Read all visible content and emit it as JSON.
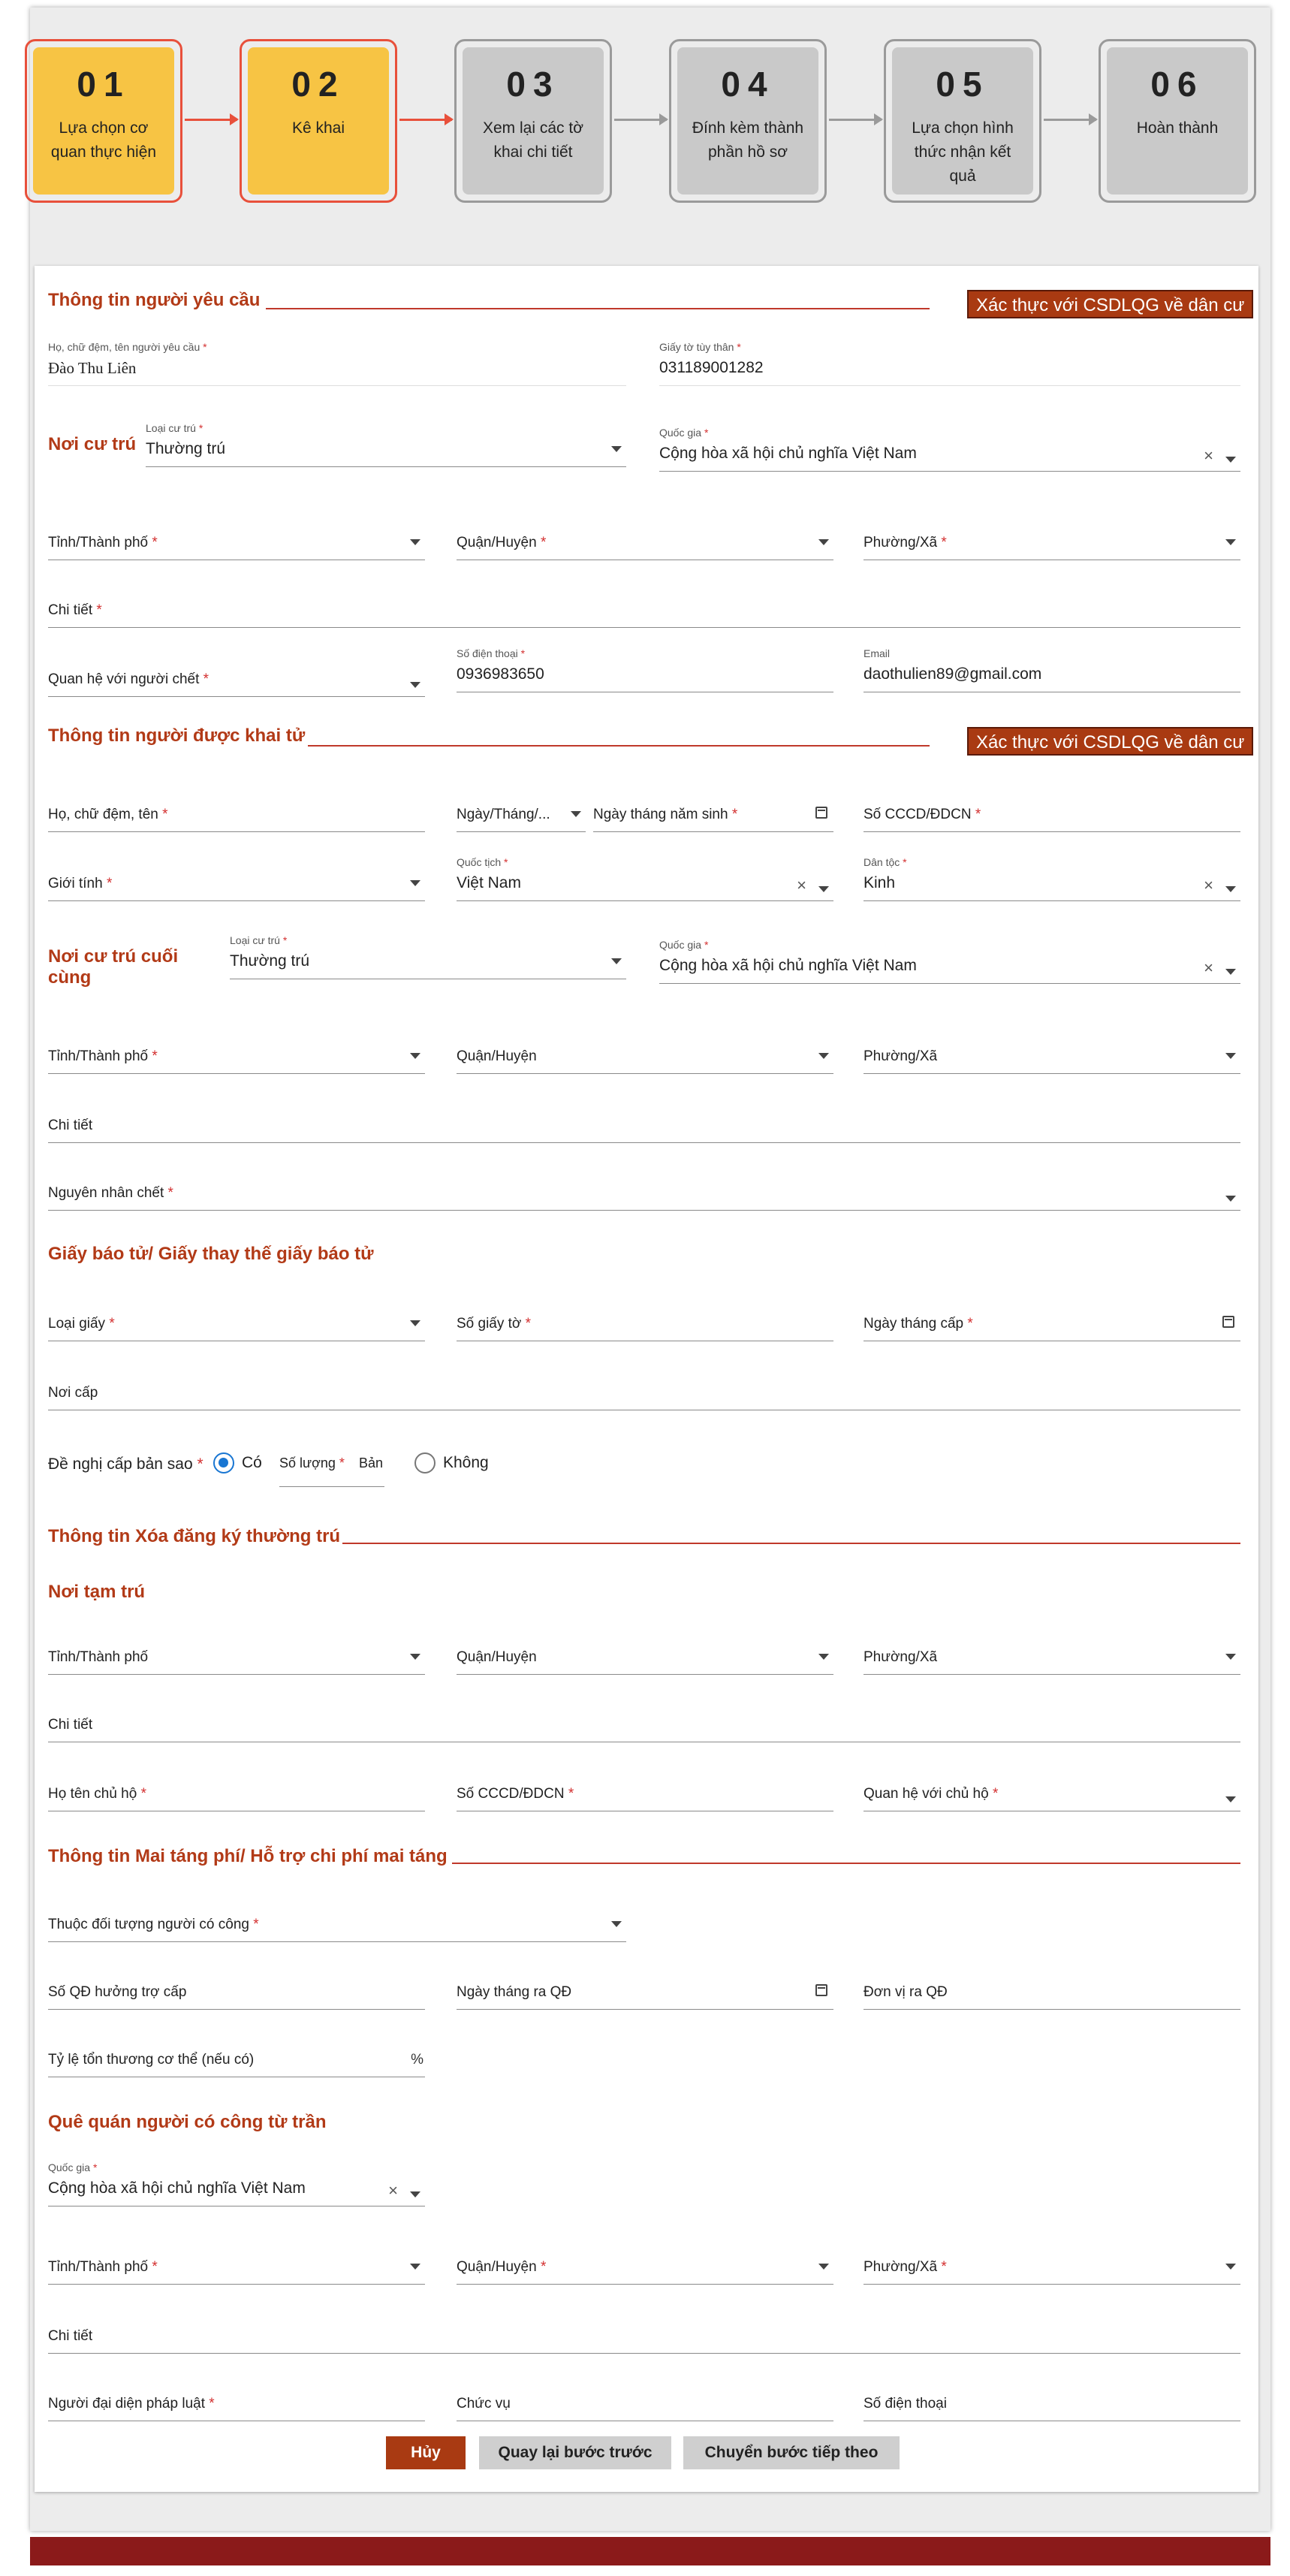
{
  "steps": [
    {
      "num": "01",
      "label": "Lựa chọn cơ quan thực hiện"
    },
    {
      "num": "02",
      "label": "Kê khai"
    },
    {
      "num": "03",
      "label": "Xem lại các tờ khai chi tiết"
    },
    {
      "num": "04",
      "label": "Đính kèm thành phần hồ sơ"
    },
    {
      "num": "05",
      "label": "Lựa chọn hình thức nhận kết quả"
    },
    {
      "num": "06",
      "label": "Hoàn thành"
    }
  ],
  "verify_label": "Xác thực với CSDLQG về dân cư",
  "req": "*",
  "requester": {
    "title": "Thông tin người yêu cầu",
    "name_label": "Họ, chữ đệm, tên người yêu cầu",
    "name_value": "Đào Thu Liên",
    "id_label": "Giấy tờ tùy thân",
    "id_value": "031189001282",
    "residence_title": "Nơi cư trú",
    "residence_type_label": "Loại cư trú",
    "residence_type_value": "Thường trú",
    "country_label": "Quốc gia",
    "country_value": "Cộng hòa xã hội chủ nghĩa Việt Nam",
    "province": "Tỉnh/Thành phố",
    "district": "Quận/Huyện",
    "ward": "Phường/Xã",
    "detail": "Chi tiết",
    "relation": "Quan hệ với người chết",
    "phone_label": "Số điện thoại",
    "phone_value": "0936983650",
    "email_label": "Email",
    "email_value": "daothulien89@gmail.com"
  },
  "deceased": {
    "title": "Thông tin người được khai tử",
    "name": "Họ, chữ đệm, tên",
    "date_format": "Ngày/Tháng/...",
    "dob": "Ngày tháng năm sinh",
    "id": "Số CCCD/ĐDCN",
    "gender": "Giới tính",
    "nationality_label": "Quốc tịch",
    "nationality_value": "Việt Nam",
    "ethnic_label": "Dân tộc",
    "ethnic_value": "Kinh",
    "last_residence_title": "Nơi cư trú cuối cùng",
    "residence_type_label": "Loại cư trú",
    "residence_type_value": "Thường trú",
    "country_label": "Quốc gia",
    "country_value": "Cộng hòa xã hội chủ nghĩa Việt Nam",
    "province": "Tỉnh/Thành phố",
    "district": "Quận/Huyện",
    "ward": "Phường/Xã",
    "detail": "Chi tiết",
    "cause": "Nguyên nhân chết"
  },
  "death_notice": {
    "title": "Giấy báo tử/ Giấy thay thế giấy báo tử",
    "type": "Loại giấy",
    "number": "Số giấy tờ",
    "date": "Ngày tháng cấp",
    "place": "Nơi cấp",
    "copy_request": "Đề nghị cấp bản sao",
    "yes": "Có",
    "qty_label": "Số lượng",
    "qty_unit": "Bản",
    "no": "Không"
  },
  "deregistration": {
    "title": "Thông tin Xóa đăng ký thường trú",
    "temp_title": "Nơi tạm trú",
    "province": "Tỉnh/Thành phố",
    "district": "Quận/Huyện",
    "ward": "Phường/Xã",
    "detail": "Chi tiết",
    "head_name": "Họ tên chủ hộ",
    "head_id": "Số CCCD/ĐDCN",
    "head_relation": "Quan hệ với chủ hộ"
  },
  "funeral": {
    "title": "Thông tin Mai táng phí/ Hỗ trợ chi phí mai táng",
    "merit": "Thuộc đối tượng người có công",
    "decision_no": "Số QĐ hưởng trợ cấp",
    "decision_date": "Ngày tháng ra QĐ",
    "decision_unit": "Đơn vị ra QĐ",
    "injury_rate": "Tỷ lệ tổn thương cơ thể (nếu có)",
    "pct": "%"
  },
  "hometown": {
    "title": "Quê quán người có công từ trần",
    "country_label": "Quốc gia",
    "country_value": "Cộng hòa xã hội chủ nghĩa Việt Nam",
    "province": "Tỉnh/Thành phố",
    "district": "Quận/Huyện",
    "ward": "Phường/Xã",
    "detail": "Chi tiết",
    "legal_rep": "Người đại diện pháp luật",
    "position": "Chức vụ",
    "phone": "Số điện thoại"
  },
  "actions": {
    "cancel": "Hủy",
    "back": "Quay lại bước trước",
    "next": "Chuyển bước tiếp theo"
  }
}
